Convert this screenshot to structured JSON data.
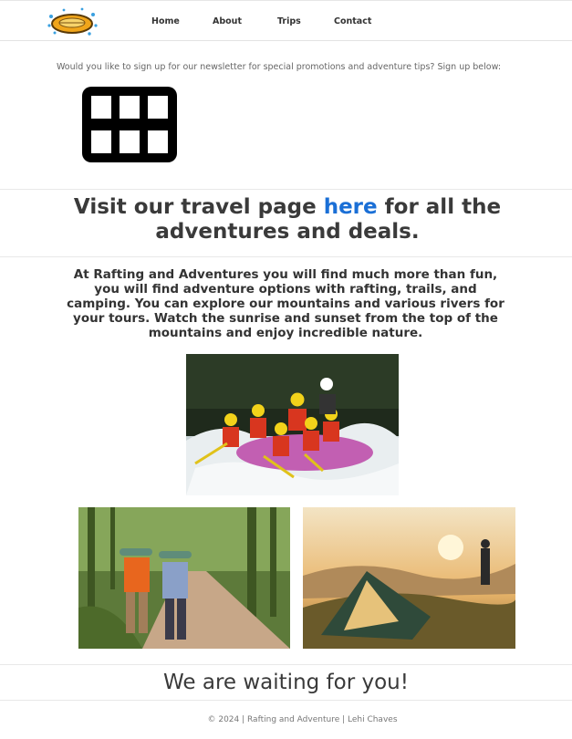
{
  "nav": {
    "items": [
      {
        "label": "Home"
      },
      {
        "label": "About"
      },
      {
        "label": "Trips"
      },
      {
        "label": "Contact"
      }
    ]
  },
  "logo": {
    "icon": "raft-logo-icon"
  },
  "newsletter": {
    "text": "Would you like to sign up for our newsletter for special promotions and adventure tips? Sign up below:",
    "icon": "grid-icon"
  },
  "travel": {
    "before": "Visit our travel page ",
    "link": "here",
    "after": " for all the adventures and deals."
  },
  "about": {
    "text": "At Rafting and Adventures you will find much more than fun, you will find adventure options with rafting, trails, and camping. You can explore our mountains and various rivers for your tours. Watch the sunrise and sunset from the top of the mountains and enjoy incredible nature."
  },
  "photos": {
    "rafting": "rafting-photo",
    "hiking": "hiking-photo",
    "camping": "camping-photo"
  },
  "waiting": {
    "text": "We are waiting for you!"
  },
  "footer": {
    "text": "© 2024 | Rafting and Adventure | Lehi Chaves"
  },
  "colors": {
    "link": "#1a6fd6",
    "text": "#3a3a3a"
  }
}
